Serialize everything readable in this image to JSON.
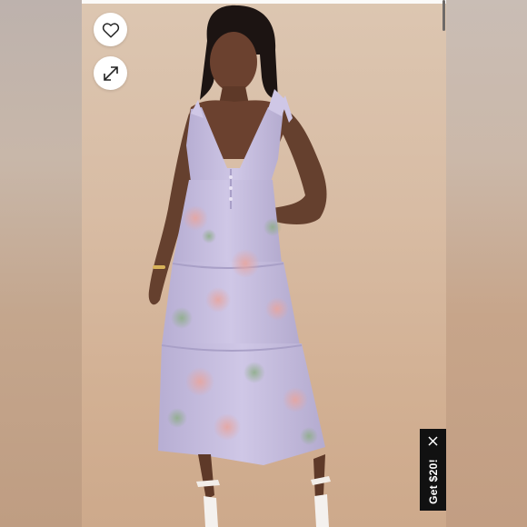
{
  "product_view": {
    "icons": {
      "favorite": "heart-outline-icon",
      "expand": "expand-arrows-icon",
      "close": "close-x-icon"
    },
    "colors": {
      "backdrop": "#d6b89f",
      "dress": "#c8bfe0",
      "skin": "#6e4330"
    }
  },
  "promo": {
    "label": "Get $20!"
  }
}
